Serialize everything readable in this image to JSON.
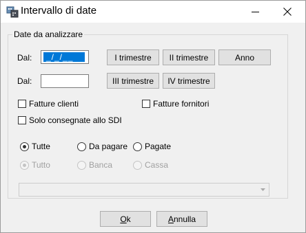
{
  "window": {
    "title": "Intervallo di date"
  },
  "group": {
    "legend": "Date da analizzare"
  },
  "row1": {
    "label": "Dal:",
    "value": "_/_/__",
    "buttons": [
      "I trimestre",
      "II trimestre",
      "Anno"
    ]
  },
  "row2": {
    "label": "Dal:",
    "value": "",
    "buttons": [
      "III trimestre",
      "IV trimestre"
    ]
  },
  "checkboxes": [
    {
      "label": "Fatture clienti",
      "checked": false
    },
    {
      "label": "Fatture fornitori",
      "checked": false
    },
    {
      "label": "Solo consegnate allo SDI",
      "checked": false
    }
  ],
  "status_radios": [
    {
      "label": "Tutte",
      "selected": true
    },
    {
      "label": "Da pagare",
      "selected": false
    },
    {
      "label": "Pagate",
      "selected": false
    }
  ],
  "method_radios": [
    {
      "label": "Tutto",
      "selected": true,
      "disabled": true
    },
    {
      "label": "Banca",
      "selected": false,
      "disabled": true
    },
    {
      "label": "Cassa",
      "selected": false,
      "disabled": true
    }
  ],
  "combo": {
    "value": ""
  },
  "footer": {
    "ok_first": "O",
    "ok_rest": "k",
    "cancel_first": "A",
    "cancel_rest": "nnulla"
  },
  "icons": [
    "calendar-app-icon",
    "minimize-icon",
    "close-icon",
    "dropdown-arrow-icon"
  ]
}
